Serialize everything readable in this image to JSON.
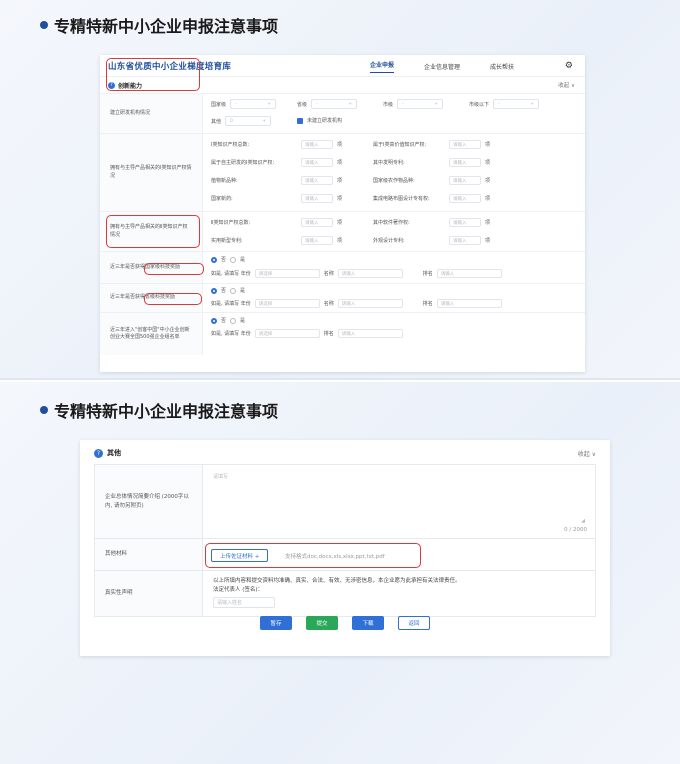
{
  "slide1": {
    "heading": "专精特新中小企业申报注意事项",
    "app": {
      "brand": "山东省优质中小企业梯度培育库",
      "nav": [
        "企业申报",
        "企业信息管理",
        "成长帮扶"
      ]
    },
    "section": {
      "title": "创新能力",
      "collapse": "收起 ∨",
      "rows": {
        "r1": {
          "label": "建立研发机构情况",
          "levels": [
            "国家级",
            "省级",
            "市级",
            "市级以下"
          ],
          "row2_label": "其他",
          "stepper_value": "0",
          "checkbox_label": "未建立研发机构"
        },
        "r2": {
          "label": "拥有与主导产品相关的Ⅰ类知识产权情况",
          "left": [
            "Ⅰ类知识产权总数:",
            "属于自主研发的Ⅰ类知识产权:",
            "植物新品种:",
            "国家新药:"
          ],
          "right": [
            "属于Ⅰ类高价值知识产权:",
            "其中发明专利:",
            "国家级农作物品种:",
            "集成电路布图设计专有权:"
          ]
        },
        "r3": {
          "label": "拥有与主导产品相关的Ⅱ类知识产权情况",
          "left": [
            "Ⅱ类知识产权总数:",
            "实用新型专利:"
          ],
          "right": [
            "其中软件著作权:",
            "外观设计专利:"
          ]
        },
        "r4": {
          "label_pre": "近三年是否",
          "label_hl": "获得国家级科技奖励",
          "no": "否",
          "yes": "是",
          "sub": "如是, 请填写 年份",
          "name": "名称",
          "rank": "排名"
        },
        "r5": {
          "label_pre": "近三年是否",
          "label_hl": "获得省级科技奖励",
          "no": "否",
          "yes": "是",
          "sub": "如是, 请填写 年份",
          "name": "名称",
          "rank": "排名"
        },
        "r6": {
          "label": "近三年进入\"创客中国\"中小企业创新创业大赛全国500强企业组名单",
          "no": "否",
          "yes": "是",
          "sub": "如是, 请填写 年份",
          "rank": "排名"
        }
      },
      "placeholder": "请输入",
      "year_placeholder": "请选择",
      "unit": "项"
    }
  },
  "slide2": {
    "heading": "专精特新中小企业申报注意事项",
    "section": {
      "title": "其他",
      "collapse": "收起 ∨",
      "intro_label": "企业总体情况简要介绍 (2000字以内, 请勿另附页)",
      "intro_placeholder": "请填写",
      "counter": "0 / 2000",
      "materials_label": "其他材料",
      "upload_button": "上传佐证材料 +",
      "upload_hint": "支持格式doc,docx,xls,xlsx,ppt,txt,pdf",
      "decl_label": "真实性声明",
      "decl_text": "以上所填内容和提交资料均准确、真实、合法、有效、无涉密信息，本企业愿为此承担有关法律责任。",
      "decl_sign": "法定代表人 (签名)：",
      "sign_placeholder": "请输入姓名",
      "buttons": [
        "暂存",
        "提交",
        "下载",
        "返回"
      ]
    }
  }
}
